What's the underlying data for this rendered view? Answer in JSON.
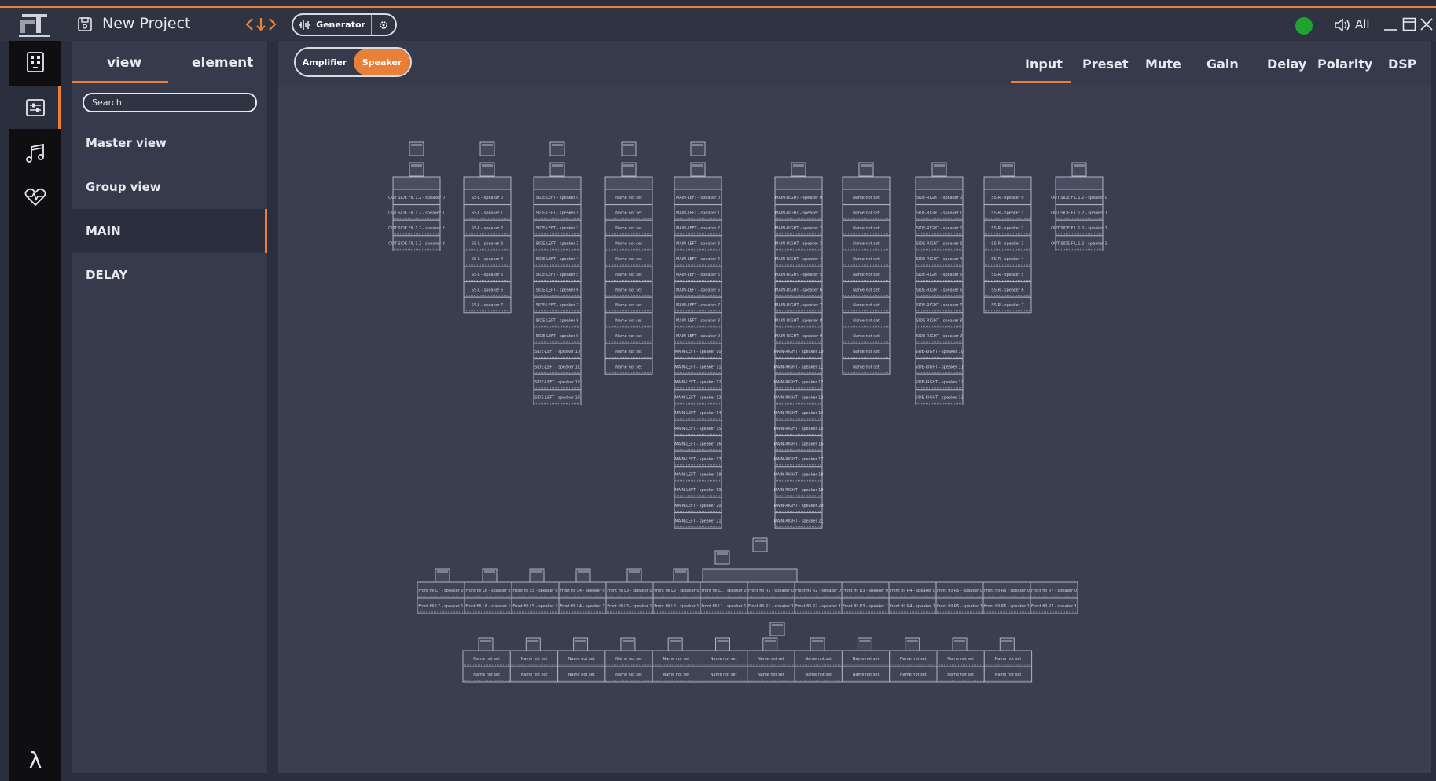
{
  "titlebar": {
    "project_title": "New Project",
    "generator_label": "Generator",
    "volume_label": "All",
    "status_color": "#1fa32e",
    "accent_color": "#e8803a"
  },
  "rail": {
    "items": [
      {
        "icon": "device-grid-icon",
        "active": false
      },
      {
        "icon": "sliders-icon",
        "active": true
      },
      {
        "icon": "music-note-icon",
        "active": false
      },
      {
        "icon": "heartbeat-icon",
        "active": false
      }
    ],
    "bottom_icon": "lambda-icon",
    "bottom_glyph": "λ"
  },
  "sidebar": {
    "tabs": [
      {
        "label": "view",
        "active": true
      },
      {
        "label": "element",
        "active": false
      }
    ],
    "search_placeholder": "Search",
    "items": [
      {
        "label": "Master view",
        "active": false
      },
      {
        "label": "Group view",
        "active": false
      },
      {
        "label": "MAIN",
        "active": true
      },
      {
        "label": "DELAY",
        "active": false
      }
    ]
  },
  "toolbar": {
    "mode_amplifier": "Amplifier",
    "mode_speaker": "Speaker",
    "active_mode": "Speaker",
    "tabs": [
      {
        "label": "Input",
        "active": true
      },
      {
        "label": "Preset",
        "active": false
      },
      {
        "label": "Mute",
        "active": false
      },
      {
        "label": "Gain",
        "active": false
      },
      {
        "label": "Delay",
        "active": false
      },
      {
        "label": "Polarity",
        "active": false
      },
      {
        "label": "DSP",
        "active": false
      }
    ]
  },
  "canvas": {
    "column_arrays": [
      {
        "prefix": "OUT SIDE FIL 1.2 - speaker",
        "count": 4,
        "amps": 2
      },
      {
        "prefix": "SS-L - speaker",
        "count": 8,
        "amps": 2
      },
      {
        "prefix": "SIDE-LEFT - speaker",
        "count": 14,
        "amps": 2
      },
      {
        "prefix": "Name not set",
        "count": 12,
        "amps": 2,
        "unnamed": true
      },
      {
        "prefix": "MAIN-LEFT - speaker",
        "count": 22,
        "amps": 2
      },
      {
        "prefix": "MAIN-RIGHT - speaker",
        "count": 22,
        "amps": 1
      },
      {
        "prefix": "Name not set",
        "count": 12,
        "amps": 1,
        "unnamed": true
      },
      {
        "prefix": "SIDE-RIGHT - speaker",
        "count": 14,
        "amps": 1
      },
      {
        "prefix": "SS-R - speaker",
        "count": 8,
        "amps": 1
      },
      {
        "prefix": "OUT SIDE FIL 1.2 - speaker",
        "count": 4,
        "amps": 1
      }
    ],
    "front_fill_row": [
      "Front fill L7",
      "Front fill L6",
      "Front fill L5",
      "Front fill L4",
      "Front fill L3",
      "Front fill L2",
      "Front fill L1",
      "Front fill R1",
      "Front fill R2",
      "Front fill R3",
      "Front fill R4",
      "Front fill R5",
      "Front fill R6",
      "Front fill R7"
    ],
    "front_fill_suffixes": [
      "- speaker 0",
      "- speaker 1"
    ],
    "delay_row_count": 12,
    "delay_row_label": "Name not set"
  }
}
